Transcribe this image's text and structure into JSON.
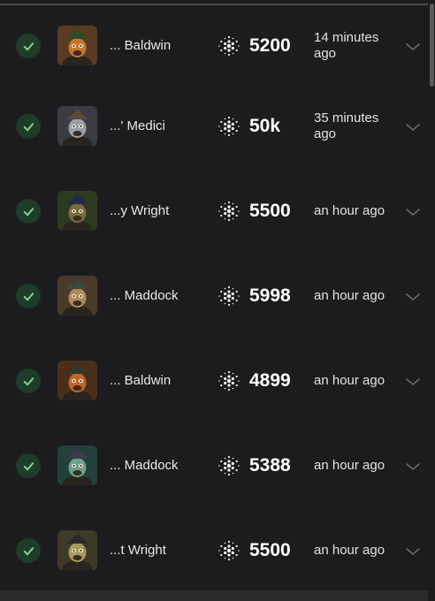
{
  "colors": {
    "background": "#1c1c1e",
    "divider": "#4a4a4e",
    "check_bg": "#1f3b2a",
    "check_mark": "#7fcf92",
    "chevron": "#6a6a6e"
  },
  "rows": [
    {
      "name": "... Baldwin",
      "amount": "5200",
      "time": "14 minutes ago",
      "status_icon": "check-icon",
      "currency_icon": "ada-icon",
      "avatar_theme": "brown"
    },
    {
      "name": "...' Medici",
      "amount": "50k",
      "time": "35 minutes ago",
      "status_icon": "check-icon",
      "currency_icon": "ada-icon",
      "avatar_theme": "grey"
    },
    {
      "name": "...y Wright",
      "amount": "5500",
      "time": "an hour ago",
      "status_icon": "check-icon",
      "currency_icon": "ada-icon",
      "avatar_theme": "olive"
    },
    {
      "name": "... Maddock",
      "amount": "5998",
      "time": "an hour ago",
      "status_icon": "check-icon",
      "currency_icon": "ada-icon",
      "avatar_theme": "tan"
    },
    {
      "name": "... Baldwin",
      "amount": "4899",
      "time": "an hour ago",
      "status_icon": "check-icon",
      "currency_icon": "ada-icon",
      "avatar_theme": "rust"
    },
    {
      "name": "... Maddock",
      "amount": "5388",
      "time": "an hour ago",
      "status_icon": "check-icon",
      "currency_icon": "ada-icon",
      "avatar_theme": "teal"
    },
    {
      "name": "...t Wright",
      "amount": "5500",
      "time": "an hour ago",
      "status_icon": "check-icon",
      "currency_icon": "ada-icon",
      "avatar_theme": "khaki"
    }
  ]
}
